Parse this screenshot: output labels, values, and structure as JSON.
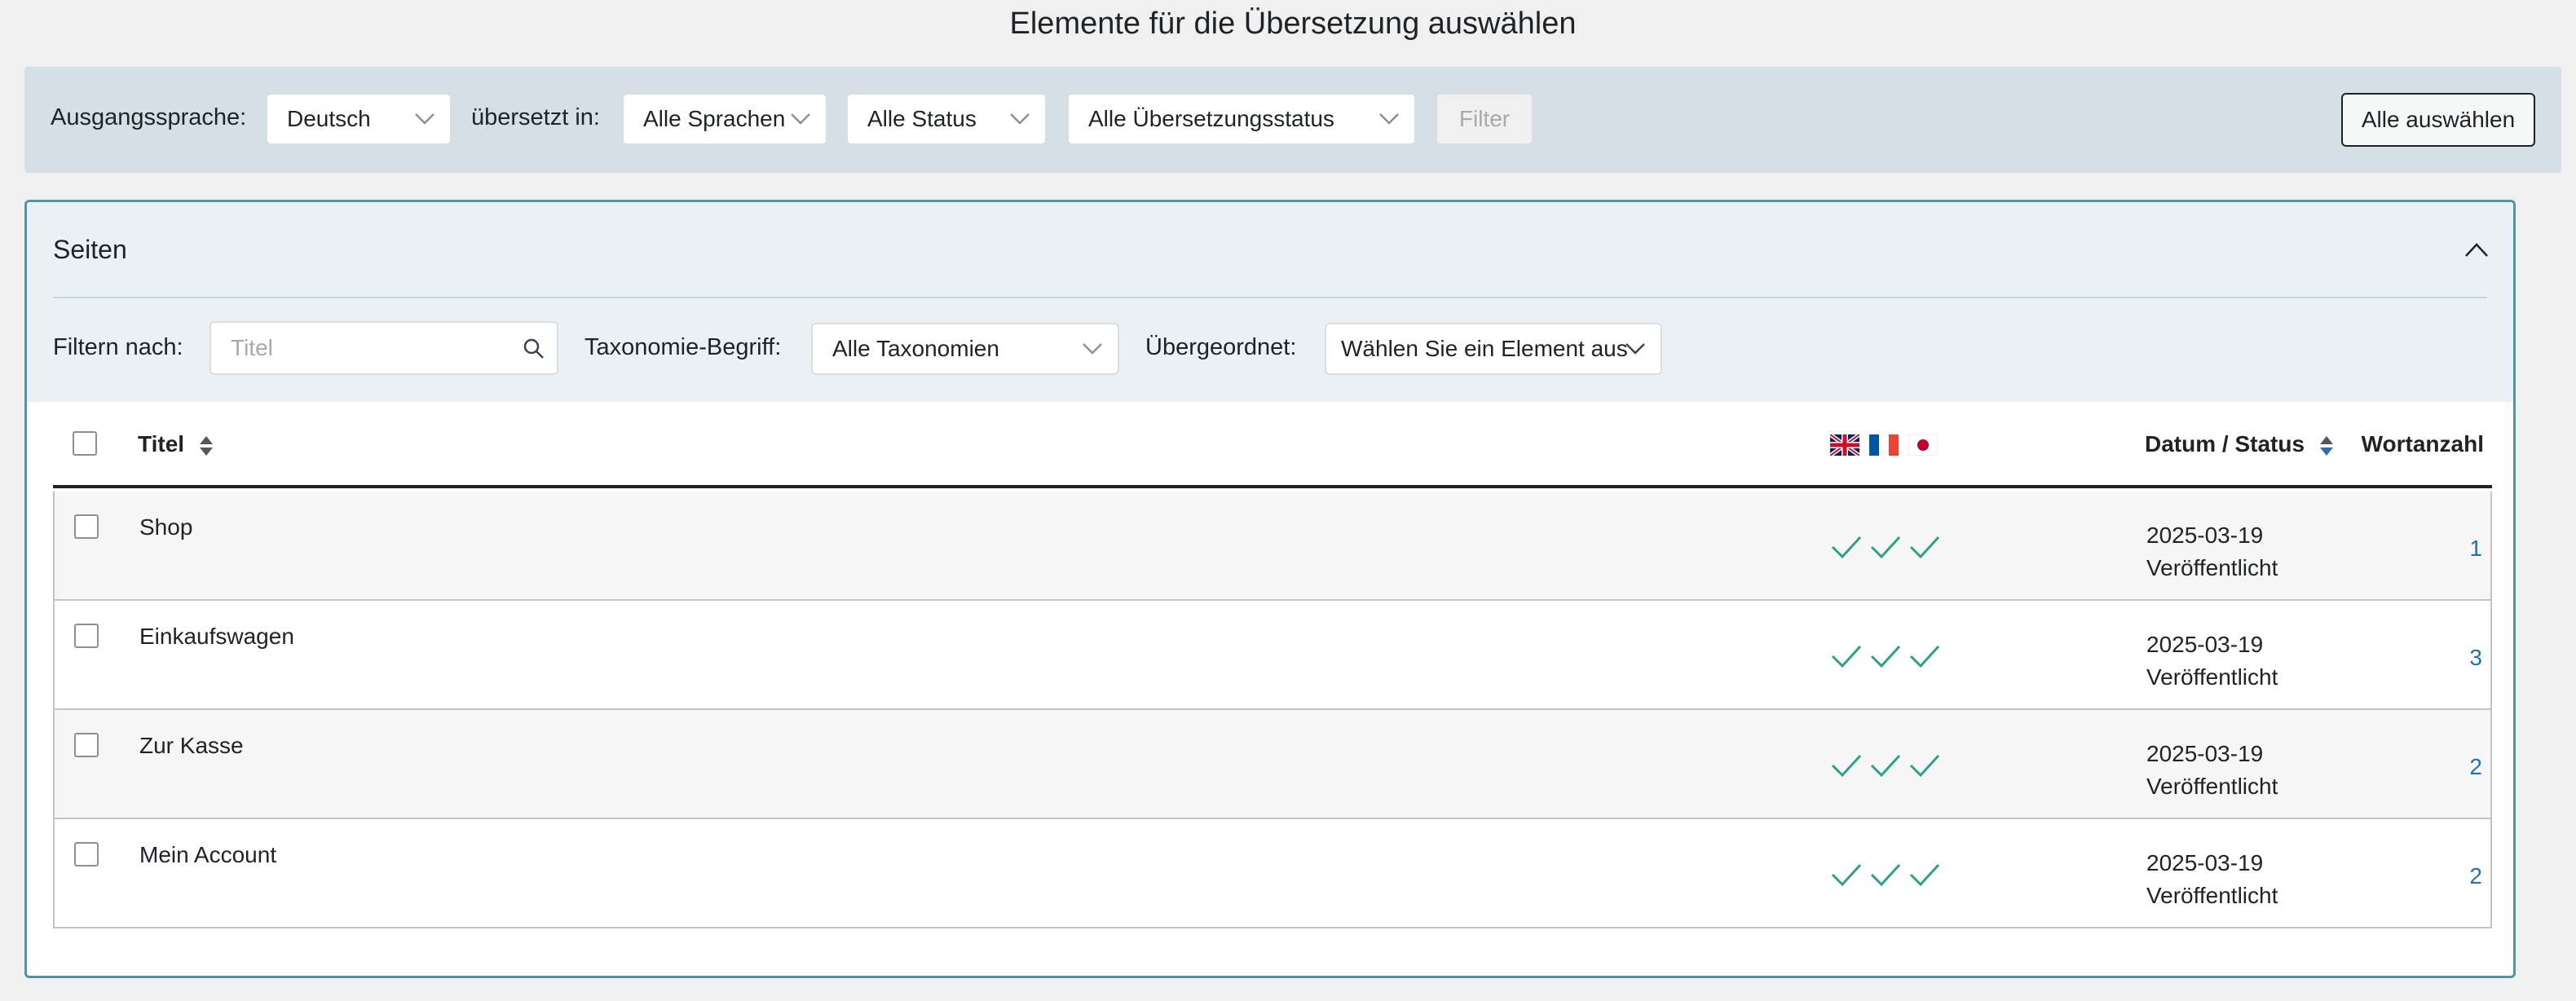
{
  "page_title": "Elemente für die Übersetzung auswählen",
  "top_filters": {
    "source_language_label": "Ausgangssprache:",
    "source_language_value": "Deutsch",
    "translated_into_label": "übersetzt in:",
    "languages_value": "Alle Sprachen",
    "status_value": "Alle Status",
    "translation_status_value": "Alle Übersetzungsstatus",
    "filter_button": "Filter",
    "select_all_button": "Alle auswählen"
  },
  "panel": {
    "title": "Seiten",
    "filter_by_label": "Filtern nach:",
    "title_placeholder": "Titel",
    "taxonomy_label": "Taxonomie-Begriff:",
    "taxonomy_value": "Alle Taxonomien",
    "parent_label": "Übergeordnet:",
    "parent_value": "Wählen Sie ein Element aus"
  },
  "table": {
    "columns": {
      "title": "Titel",
      "date_status": "Datum / Status",
      "word_count": "Wortanzahl"
    },
    "language_flags": [
      "flag-gb-icon",
      "flag-fr-icon",
      "flag-jp-icon"
    ],
    "rows": [
      {
        "title": "Shop",
        "date": "2025-03-19",
        "status": "Veröffentlicht",
        "word_count": "1"
      },
      {
        "title": "Einkaufswagen",
        "date": "2025-03-19",
        "status": "Veröffentlicht",
        "word_count": "3"
      },
      {
        "title": "Zur Kasse",
        "date": "2025-03-19",
        "status": "Veröffentlicht",
        "word_count": "2"
      },
      {
        "title": "Mein Account",
        "date": "2025-03-19",
        "status": "Veröffentlicht",
        "word_count": "2"
      }
    ]
  },
  "colors": {
    "accent": "#4f94a8",
    "check": "#2aa189",
    "link": "#2271b1"
  }
}
